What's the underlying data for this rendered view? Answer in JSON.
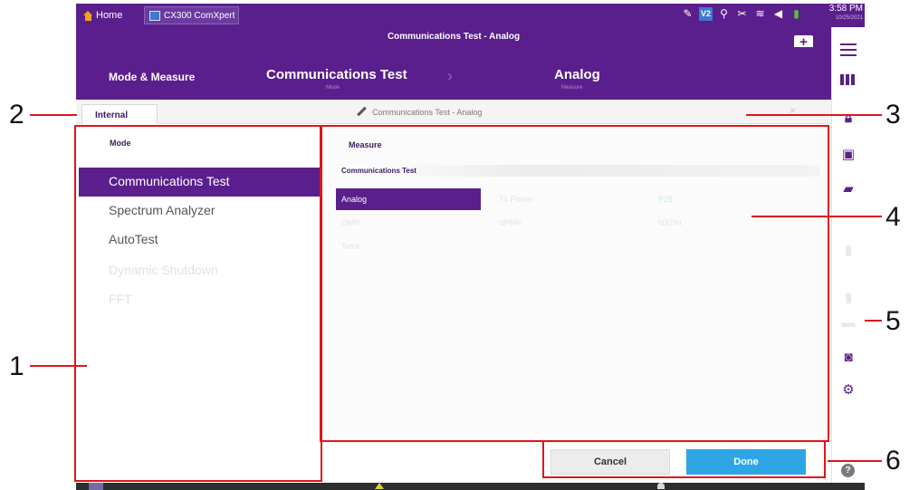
{
  "topbar": {
    "home_label": "Home",
    "app_tab_label": "CX300 ComXpert",
    "status_icons": [
      "pencil-wrench-icon",
      "v2-icon",
      "search-icon",
      "tools-icon",
      "wifi-icon",
      "speaker-icon",
      "battery-icon"
    ],
    "time": "3:58 PM",
    "date": "10/25/2021"
  },
  "titlebar": {
    "title": "Communications Test - Analog"
  },
  "navbar": {
    "mode_measure_label": "Mode & Measure",
    "communications_test_label": "Communications Test",
    "communications_test_sub": "Mode",
    "analog_label": "Analog",
    "analog_sub": "Measure"
  },
  "tabs": {
    "internal_label": "Internal",
    "edit_title": "Communications Test - Analog",
    "close_symbol": "×"
  },
  "mode_panel": {
    "title": "Mode",
    "items": [
      {
        "label": "Communications Test",
        "selected": true
      },
      {
        "label": "Spectrum Analyzer",
        "selected": false
      },
      {
        "label": "AutoTest",
        "selected": false
      },
      {
        "label": "Dynamic Shutdown",
        "selected": false
      },
      {
        "label": "FFT",
        "selected": false
      }
    ]
  },
  "measure_panel": {
    "title": "Measure",
    "group_label": "Communications Test",
    "items": [
      {
        "label": "Analog",
        "selected": true
      },
      {
        "label": "Tx Power",
        "selected": false
      },
      {
        "label": "P25",
        "selected": false
      },
      {
        "label": "DMR",
        "selected": false
      },
      {
        "label": "dPMR",
        "selected": false
      },
      {
        "label": "NXDN",
        "selected": false
      },
      {
        "label": "Tetra",
        "selected": false
      }
    ]
  },
  "footer": {
    "cancel_label": "Cancel",
    "done_label": "Done"
  },
  "annotations": [
    "1",
    "2",
    "3",
    "4",
    "5",
    "6"
  ],
  "colors": {
    "brand_purple": "#5a1f8c",
    "done_blue": "#2ea6e6",
    "annotation_red": "#e0151b"
  }
}
